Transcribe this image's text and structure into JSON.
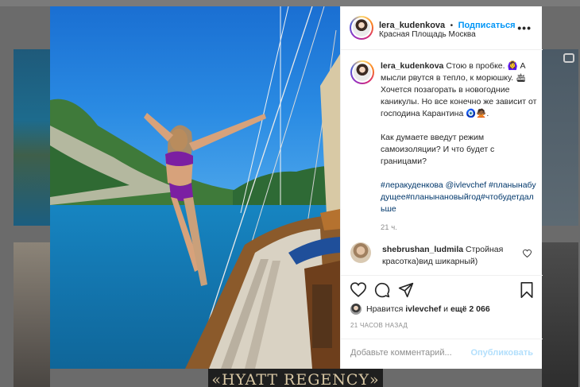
{
  "post": {
    "username": "lera_kudenkova",
    "follow_label": "Подписаться",
    "separator": "•",
    "location": "Красная Площадь Москва",
    "caption_username": "lera_kudenkova",
    "caption_line1": "Стою в пробке. 🙆‍♀️ А мысли рвутся в тепло, к морюшку. 🛳 Хочется позагорать в новогодние каникулы. Но все конечно же зависит от господина Карантина 🧿🙅🏾.",
    "caption_line2": "Как думаете введут режим самоизоляции? И что будет с границами?",
    "hashtags": "#леракуденкова @ivlevchef #планынабудущее#планынановыйгод#чтобудетдальше",
    "caption_time": "21 ч.",
    "comment_username": "shebrushan_ludmila",
    "comment_text": "Стройная красотка)вид шикарный)",
    "liked_prefix": "Нравится",
    "liked_user": "ivlevchef",
    "liked_and": "и",
    "liked_more": "ещё 2 066",
    "posted_ago": "21 ЧАСОВ НАЗАД",
    "add_comment_placeholder": "Добавьте комментарий...",
    "publish_label": "Опубликовать"
  },
  "background": {
    "banner_text": "«HYATT REGENCY»"
  },
  "icons": {
    "more": "more-options-icon",
    "like": "heart-icon",
    "comment": "comment-icon",
    "share": "share-icon",
    "save": "bookmark-icon",
    "comment_like": "heart-small-icon"
  },
  "colors": {
    "accent": "#0095f6",
    "text": "#262626",
    "muted": "#8e8e8e",
    "hashtag": "#00376b"
  }
}
